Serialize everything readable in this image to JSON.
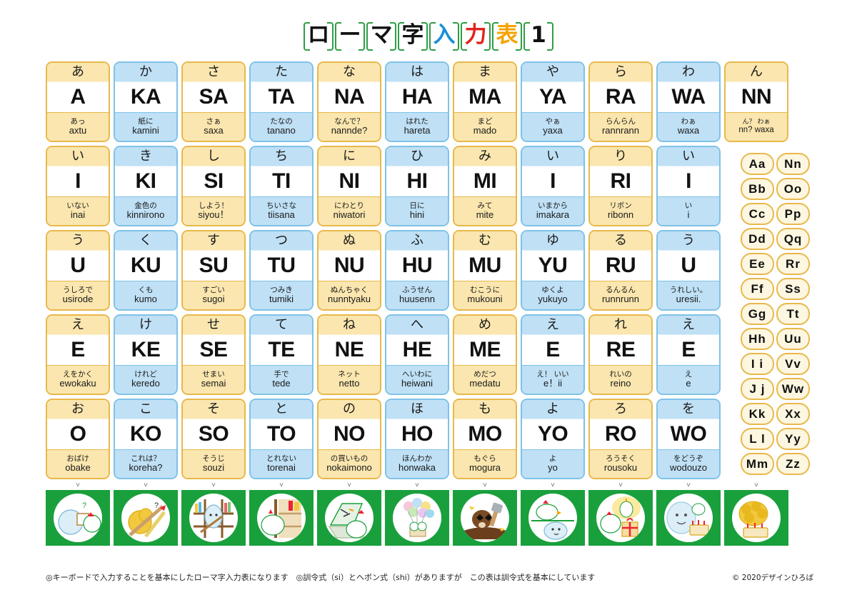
{
  "title": {
    "chars": [
      {
        "ch": "ロ",
        "color": "#111111"
      },
      {
        "ch": "ー",
        "color": "#111111"
      },
      {
        "ch": "マ",
        "color": "#111111"
      },
      {
        "ch": "字",
        "color": "#111111"
      },
      {
        "ch": "入",
        "color": "#1b8fd6"
      },
      {
        "ch": "力",
        "color": "#e2231a"
      },
      {
        "ch": "表",
        "color": "#f5a200"
      },
      {
        "ch": "1",
        "color": "#111111"
      }
    ],
    "frame_color": "#2e9e45",
    "full_text": "ローマ字入力表1"
  },
  "colors": {
    "yellow_border": "#e8b84b",
    "yellow_fill": "#fae6ae",
    "blue_border": "#7ec2e8",
    "blue_fill": "#bfe0f5",
    "green": "#19a03c",
    "white": "#ffffff"
  },
  "grid": {
    "columns": [
      {
        "name": "a-column",
        "tone": "yellow"
      },
      {
        "name": "ka-column",
        "tone": "blue"
      },
      {
        "name": "sa-column",
        "tone": "yellow"
      },
      {
        "name": "ta-column",
        "tone": "blue"
      },
      {
        "name": "na-column",
        "tone": "yellow"
      },
      {
        "name": "ha-column",
        "tone": "blue"
      },
      {
        "name": "ma-column",
        "tone": "yellow"
      },
      {
        "name": "ya-column",
        "tone": "blue"
      },
      {
        "name": "ra-column",
        "tone": "yellow"
      },
      {
        "name": "wa-column",
        "tone": "blue"
      },
      {
        "name": "nn-column",
        "tone": "yellow"
      }
    ],
    "rows": [
      [
        {
          "kana": "あ",
          "romaji": "A",
          "ex_jp": "あっ",
          "ex_ro": "axtu"
        },
        {
          "kana": "か",
          "romaji": "KA",
          "ex_jp": "紙に",
          "ex_ro": "kamini"
        },
        {
          "kana": "さ",
          "romaji": "SA",
          "ex_jp": "さぁ",
          "ex_ro": "saxa"
        },
        {
          "kana": "た",
          "romaji": "TA",
          "ex_jp": "たなの",
          "ex_ro": "tanano"
        },
        {
          "kana": "な",
          "romaji": "NA",
          "ex_jp": "なんで？",
          "ex_ro": "nannde?"
        },
        {
          "kana": "は",
          "romaji": "HA",
          "ex_jp": "はれた",
          "ex_ro": "hareta"
        },
        {
          "kana": "ま",
          "romaji": "MA",
          "ex_jp": "まど",
          "ex_ro": "mado"
        },
        {
          "kana": "や",
          "romaji": "YA",
          "ex_jp": "やぁ",
          "ex_ro": "yaxa"
        },
        {
          "kana": "ら",
          "romaji": "RA",
          "ex_jp": "らんらん",
          "ex_ro": "rannrann"
        },
        {
          "kana": "わ",
          "romaji": "WA",
          "ex_jp": "わぁ",
          "ex_ro": "waxa"
        },
        {
          "kana": "ん",
          "romaji": "NN",
          "ex_jp": "ん？ わぁ",
          "ex_ro": "nn? waxa",
          "small": true
        }
      ],
      [
        {
          "kana": "い",
          "romaji": "I",
          "ex_jp": "いない",
          "ex_ro": "inai"
        },
        {
          "kana": "き",
          "romaji": "KI",
          "ex_jp": "金色の",
          "ex_ro": "kinnirono"
        },
        {
          "kana": "し",
          "romaji": "SI",
          "ex_jp": "しよう！",
          "ex_ro": "siyou！"
        },
        {
          "kana": "ち",
          "romaji": "TI",
          "ex_jp": "ちいさな",
          "ex_ro": "tiisana"
        },
        {
          "kana": "に",
          "romaji": "NI",
          "ex_jp": "にわとり",
          "ex_ro": "niwatori"
        },
        {
          "kana": "ひ",
          "romaji": "HI",
          "ex_jp": "日に",
          "ex_ro": "hini"
        },
        {
          "kana": "み",
          "romaji": "MI",
          "ex_jp": "みて",
          "ex_ro": "mite"
        },
        {
          "kana": "い",
          "romaji": "I",
          "ex_jp": "いまから",
          "ex_ro": "imakara"
        },
        {
          "kana": "り",
          "romaji": "RI",
          "ex_jp": "リボン",
          "ex_ro": "ribonn"
        },
        {
          "kana": "い",
          "romaji": "I",
          "ex_jp": "い",
          "ex_ro": "i"
        },
        {
          "kana": "",
          "romaji": "",
          "ex_jp": "",
          "ex_ro": "",
          "empty": true
        }
      ],
      [
        {
          "kana": "う",
          "romaji": "U",
          "ex_jp": "うしろで",
          "ex_ro": "usirode"
        },
        {
          "kana": "く",
          "romaji": "KU",
          "ex_jp": "くも",
          "ex_ro": "kumo"
        },
        {
          "kana": "す",
          "romaji": "SU",
          "ex_jp": "すごい",
          "ex_ro": "sugoi"
        },
        {
          "kana": "つ",
          "romaji": "TU",
          "ex_jp": "つみき",
          "ex_ro": "tumiki"
        },
        {
          "kana": "ぬ",
          "romaji": "NU",
          "ex_jp": "ぬんちゃく",
          "ex_ro": "nunntyaku"
        },
        {
          "kana": "ふ",
          "romaji": "HU",
          "ex_jp": "ふうせん",
          "ex_ro": "huusenn"
        },
        {
          "kana": "む",
          "romaji": "MU",
          "ex_jp": "むこうに",
          "ex_ro": "mukouni"
        },
        {
          "kana": "ゆ",
          "romaji": "YU",
          "ex_jp": "ゆくよ",
          "ex_ro": "yukuyo"
        },
        {
          "kana": "る",
          "romaji": "RU",
          "ex_jp": "るんるん",
          "ex_ro": "runnrunn"
        },
        {
          "kana": "う",
          "romaji": "U",
          "ex_jp": "うれしい。",
          "ex_ro": "uresii."
        },
        {
          "kana": "",
          "romaji": "",
          "ex_jp": "",
          "ex_ro": "",
          "empty": true
        }
      ],
      [
        {
          "kana": "え",
          "romaji": "E",
          "ex_jp": "えをかく",
          "ex_ro": "ewokaku"
        },
        {
          "kana": "け",
          "romaji": "KE",
          "ex_jp": "けれど",
          "ex_ro": "keredo"
        },
        {
          "kana": "せ",
          "romaji": "SE",
          "ex_jp": "せまい",
          "ex_ro": "semai"
        },
        {
          "kana": "て",
          "romaji": "TE",
          "ex_jp": "手で",
          "ex_ro": "tede"
        },
        {
          "kana": "ね",
          "romaji": "NE",
          "ex_jp": "ネット",
          "ex_ro": "netto"
        },
        {
          "kana": "へ",
          "romaji": "HE",
          "ex_jp": "へいわに",
          "ex_ro": "heiwani"
        },
        {
          "kana": "め",
          "romaji": "ME",
          "ex_jp": "めだつ",
          "ex_ro": "medatu"
        },
        {
          "kana": "え",
          "romaji": "E",
          "ex_jp": "え！ いい",
          "ex_ro": "e！ii"
        },
        {
          "kana": "れ",
          "romaji": "RE",
          "ex_jp": "れいの",
          "ex_ro": "reino"
        },
        {
          "kana": "え",
          "romaji": "E",
          "ex_jp": "え",
          "ex_ro": "e"
        },
        {
          "kana": "",
          "romaji": "",
          "ex_jp": "",
          "ex_ro": "",
          "empty": true
        }
      ],
      [
        {
          "kana": "お",
          "romaji": "O",
          "ex_jp": "おばけ",
          "ex_ro": "obake"
        },
        {
          "kana": "こ",
          "romaji": "KO",
          "ex_jp": "これは？",
          "ex_ro": "koreha?"
        },
        {
          "kana": "そ",
          "romaji": "SO",
          "ex_jp": "そうじ",
          "ex_ro": "souzi"
        },
        {
          "kana": "と",
          "romaji": "TO",
          "ex_jp": "とれない",
          "ex_ro": "torenai"
        },
        {
          "kana": "の",
          "romaji": "NO",
          "ex_jp": "の買いもの",
          "ex_ro": "nokaimono"
        },
        {
          "kana": "ほ",
          "romaji": "HO",
          "ex_jp": "ほんわか",
          "ex_ro": "honwaka"
        },
        {
          "kana": "も",
          "romaji": "MO",
          "ex_jp": "もぐら",
          "ex_ro": "mogura"
        },
        {
          "kana": "よ",
          "romaji": "YO",
          "ex_jp": "よ",
          "ex_ro": "yo"
        },
        {
          "kana": "ろ",
          "romaji": "RO",
          "ex_jp": "ろうそく",
          "ex_ro": "rousoku"
        },
        {
          "kana": "を",
          "romaji": "WO",
          "ex_jp": "をどうぞ",
          "ex_ro": "wodouzo"
        },
        {
          "kana": "",
          "romaji": "",
          "ex_jp": "",
          "ex_ro": "",
          "empty": true
        }
      ]
    ]
  },
  "alphabet": {
    "rows": [
      {
        "left": "Aa",
        "right": "Nn"
      },
      {
        "left": "Bb",
        "right": "Oo"
      },
      {
        "left": "Cc",
        "right": "Pp"
      },
      {
        "left": "Dd",
        "right": "Qq"
      },
      {
        "left": "Ee",
        "right": "Rr"
      },
      {
        "left": "Ff",
        "right": "Ss"
      },
      {
        "left": "Gg",
        "right": "Tt"
      },
      {
        "left": "Hh",
        "right": "Uu"
      },
      {
        "left": "I i",
        "right": "Vv"
      },
      {
        "left": "J j",
        "right": "Ww"
      },
      {
        "left": "Kk",
        "right": "Xx"
      },
      {
        "left": "L l",
        "right": "Yy"
      },
      {
        "left": "Mm",
        "right": "Zz"
      }
    ]
  },
  "chevron": "˅",
  "illustrations": [
    {
      "name": "illustration-a-chick-with-picture-frame"
    },
    {
      "name": "illustration-ka-paper-and-pencils"
    },
    {
      "name": "illustration-sa-ghost-in-bookshelf"
    },
    {
      "name": "illustration-ta-chick-on-shelf"
    },
    {
      "name": "illustration-na-chick-at-laptop"
    },
    {
      "name": "illustration-ha-balloon-basket-chicks"
    },
    {
      "name": "illustration-ma-mole-with-shovel"
    },
    {
      "name": "illustration-ya-chick-and-ghost-sleeping"
    },
    {
      "name": "illustration-ra-chick-with-gift"
    },
    {
      "name": "illustration-wa-ghost-with-birthday-cake"
    },
    {
      "name": "illustration-nn-candles-and-cake"
    }
  ],
  "footer": {
    "note": "◎キーボードで入力することを基本にしたローマ字入力表になります　◎訓令式（si）とヘボン式（shi）がありますが　この表は訓令式を基本にしています",
    "copyright": "© 2020デザインひろば"
  }
}
